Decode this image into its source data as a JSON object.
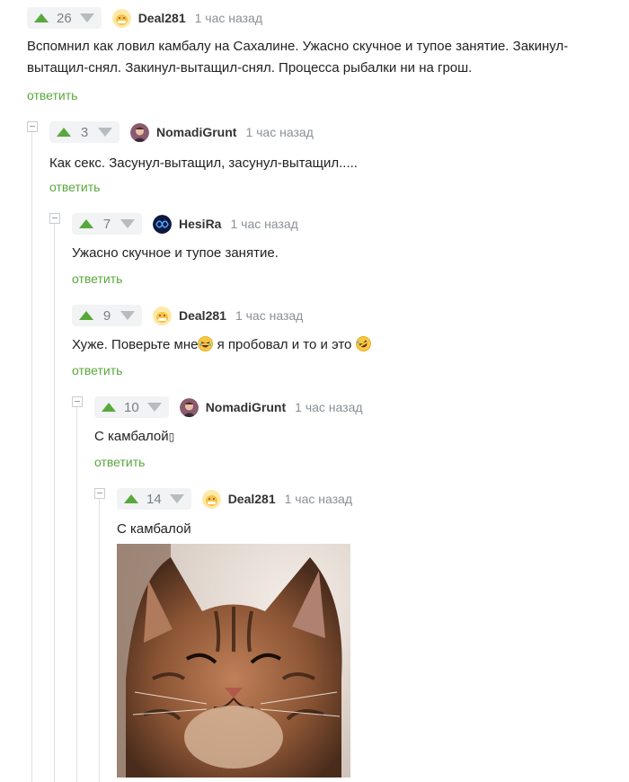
{
  "comments": [
    {
      "score": "26",
      "author": "Deal281",
      "time": "1 час назад",
      "text": "Вспомнил как ловил камбалу на Сахалине. Ужасно скучное и тупое занятие. Закинул-вытащил-снял. Закинул-вытащил-снял. Процесса рыбалки ни на грош.",
      "reply": "ответить"
    },
    {
      "score": "3",
      "author": "NomadiGrunt",
      "time": "1 час назад",
      "text": "Как секс. Засунул-вытащил, засунул-вытащил.....",
      "reply": "ответить"
    },
    {
      "score": "7",
      "author": "HesiRa",
      "time": "1 час назад",
      "text": "Ужасно скучное и тупое занятие.",
      "reply": "ответить"
    },
    {
      "score": "9",
      "author": "Deal281",
      "time": "1 час назад",
      "text_before": "Хуже. Поверьте мне",
      "text_middle": " я пробовал и то и это ",
      "reply": "ответить"
    },
    {
      "score": "10",
      "author": "NomadiGrunt",
      "time": "1 час назад",
      "text": "С камбалой",
      "text_suffix": "▯",
      "reply": "ответить"
    },
    {
      "score": "14",
      "author": "Deal281",
      "time": "1 час назад",
      "text": "С камбалой"
    }
  ],
  "colors": {
    "accent": "#59a83b",
    "downvote": "#b7bcc0",
    "meta": "#8a9096"
  },
  "icons": [
    "upvote-arrow-icon",
    "downvote-arrow-icon",
    "collapse-icon",
    "laughing-emoji-icon",
    "rofl-emoji-icon"
  ]
}
